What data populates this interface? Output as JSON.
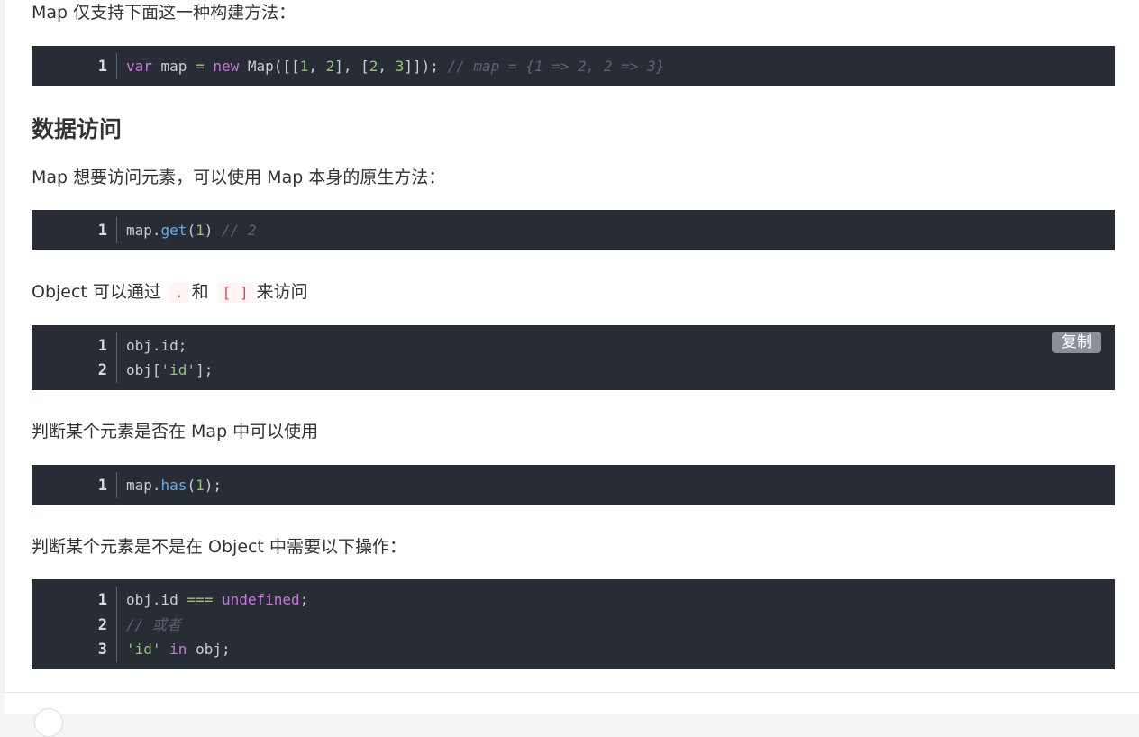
{
  "paragraphs": {
    "p1": "Map 仅支持下面这一种构建方法：",
    "p2": "Map 想要访问元素，可以使用 Map 本身的原生方法：",
    "p3_a": "Object 可以通过",
    "p3_code1": ".",
    "p3_b": "和",
    "p3_code2": "[ ]",
    "p3_c": "来访问",
    "p4": "判断某个元素是否在 Map 中可以使用",
    "p5": "判断某个元素是不是在 Object 中需要以下操作："
  },
  "heading": "数据访问",
  "copy_label": "复制",
  "code_blocks": {
    "b1": {
      "line_numbers": [
        "1"
      ],
      "l1": {
        "kw1": "var",
        "t1": " map ",
        "op1": "=",
        "t2": " ",
        "kw2": "new",
        "t3": " Map([[",
        "n1": "1",
        "t4": ", ",
        "n2": "2",
        "t5": "], [",
        "n3": "2",
        "t6": ", ",
        "n4": "3",
        "t7": "]]); ",
        "cm": "// map = {1 => 2, 2 => 3}"
      }
    },
    "b2": {
      "line_numbers": [
        "1"
      ],
      "l1": {
        "t1": "map.",
        "fn": "get",
        "t2": "(",
        "n1": "1",
        "t3": ") ",
        "cm": "// 2"
      }
    },
    "b3": {
      "line_numbers": [
        "1",
        "2"
      ],
      "l1": "obj.id;",
      "l2": {
        "t1": "obj[",
        "s1": "'id'",
        "t2": "];"
      }
    },
    "b4": {
      "line_numbers": [
        "1"
      ],
      "l1": {
        "t1": "map.",
        "fn": "has",
        "t2": "(",
        "n1": "1",
        "t3": ");"
      }
    },
    "b5": {
      "line_numbers": [
        "1",
        "2",
        "3"
      ],
      "l1": {
        "t1": "obj.id ",
        "op1": "===",
        "t2": " ",
        "kw1": "undefined",
        "t3": ";"
      },
      "l2": {
        "cm": "// 或者"
      },
      "l3": {
        "s1": "'id'",
        "t1": " ",
        "kw1": "in",
        "t2": " obj;"
      }
    }
  },
  "colors": {
    "code_bg": "#282c34",
    "keyword": "#c678dd",
    "number": "#98c379",
    "string": "#98c379",
    "function": "#61afef",
    "comment": "#5c6370",
    "inline_code": "#e83e63"
  }
}
